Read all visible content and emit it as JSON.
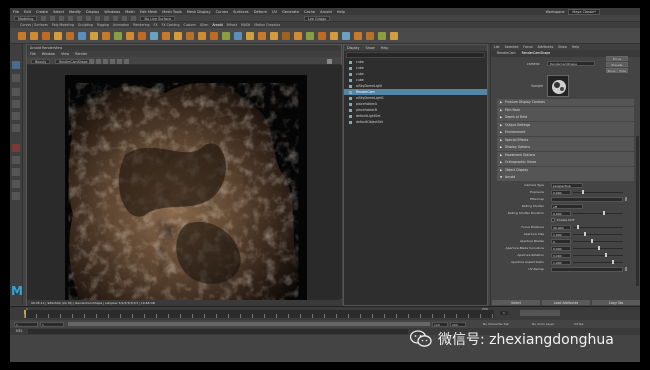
{
  "menubar": {
    "items": [
      "File",
      "Edit",
      "Create",
      "Select",
      "Modify",
      "Display",
      "Windows",
      "Mesh",
      "Edit Mesh",
      "Mesh Tools",
      "Mesh Display",
      "Curves",
      "Surfaces",
      "Deform",
      "UV",
      "Generate",
      "Cache",
      "Arnold",
      "Help"
    ],
    "workspace_label": "Workspace:",
    "workspace_value": "Maya Classic*"
  },
  "statusline": {
    "mode": "Modeling",
    "live_surface": "No Live Surface",
    "login": "Lee Griggs"
  },
  "shelf_tabs": [
    "Curves / Surfaces",
    "Poly Modeling",
    "Sculpting",
    "Rigging",
    "Animation",
    "Rendering",
    "FX",
    "FX Caching",
    "Custom",
    "XGen",
    "Arnold",
    "Bifrost",
    "MASH",
    "Motion Graphics"
  ],
  "shelf_active_tab": "Arnold",
  "render_view": {
    "title": "Arnold RenderView",
    "menu": [
      "File",
      "Window",
      "View",
      "Render"
    ],
    "display_mode": "Beauty",
    "camera": "RenderCamShape",
    "status": "00:05:11 | 960x540 (x0.76) | RenderCamShape | samples 3/2/3/3/3/3/3 | 19.68 GB"
  },
  "outliner": {
    "menu": [
      "Display",
      "Show",
      "Help"
    ],
    "items": [
      {
        "label": "cube",
        "selected": false
      },
      {
        "label": "cube",
        "selected": false
      },
      {
        "label": "cube",
        "selected": false
      },
      {
        "label": "cube",
        "selected": false
      },
      {
        "label": "aiSkyDomeLight",
        "selected": false
      },
      {
        "label": "RenderCam",
        "selected": true
      },
      {
        "label": "aiSkyDomeLight1",
        "selected": false
      },
      {
        "label": "placeholderA",
        "selected": false
      },
      {
        "label": "placeholderB",
        "selected": false
      },
      {
        "label": "defaultLightSet",
        "selected": false
      },
      {
        "label": "defaultObjectSet",
        "selected": false
      }
    ]
  },
  "attribute_editor": {
    "menu": [
      "List",
      "Selected",
      "Focus",
      "Attributes",
      "Show",
      "Help"
    ],
    "tabs": [
      "RenderCam",
      "RenderCamShape"
    ],
    "camera_label": "camera:",
    "camera_value": "RenderCamShape",
    "focus_button": "Focus",
    "presets_button": "Presets",
    "show_button": "Show",
    "hide_button": "Hide",
    "sample_label": "Sample",
    "sections": [
      "Frustum Display Controls",
      "Film Back",
      "Depth of Field",
      "Output Settings",
      "Environment",
      "Special Effects",
      "Display Options",
      "Movement Options",
      "Orthographic Views",
      "Object Display",
      "Arnold"
    ],
    "arnold_rows": [
      {
        "label": "Camera Type",
        "value": "perspective",
        "kind": "dropdown"
      },
      {
        "label": "Exposure",
        "value": "0.000",
        "kind": "slider"
      },
      {
        "label": "Filtermap",
        "value": "",
        "kind": "map"
      },
      {
        "label": "Rolling Shutter",
        "value": "off",
        "kind": "dropdown"
      },
      {
        "label": "Rolling Shutter Duration",
        "value": "0.000",
        "kind": "slider"
      },
      {
        "label": "",
        "value": "Enable DOF",
        "kind": "checkbox"
      },
      {
        "label": "Focus Distance",
        "value": "30.000",
        "kind": "slider"
      },
      {
        "label": "Aperture Size",
        "value": "1.900",
        "kind": "slider"
      },
      {
        "label": "Aperture Blades",
        "value": "0",
        "kind": "slider"
      },
      {
        "label": "Aperture Blade Curvature",
        "value": "0.000",
        "kind": "slider"
      },
      {
        "label": "Aperture Rotation",
        "value": "0.000",
        "kind": "slider"
      },
      {
        "label": "Aperture Aspect Ratio",
        "value": "1.000",
        "kind": "slider"
      },
      {
        "label": "UV Remap",
        "value": "",
        "kind": "map"
      }
    ],
    "bottom_buttons": [
      "Select",
      "Load Attributes",
      "Copy Tab"
    ]
  },
  "timeline": {
    "start": "1",
    "end": "200",
    "current": "1"
  },
  "range": {
    "start": "1",
    "start2": "1",
    "end": "120",
    "end2": "200",
    "fps": "24 fps",
    "char_set": "No Character Set",
    "anim_layer": "No Anim Layer"
  },
  "cmdline": {
    "label": "MEL"
  },
  "watermark": {
    "text": "微信号: zhexiangdonghua"
  },
  "colors": {
    "accent": "#5285a6",
    "maya_logo": "#2fa6d8"
  }
}
